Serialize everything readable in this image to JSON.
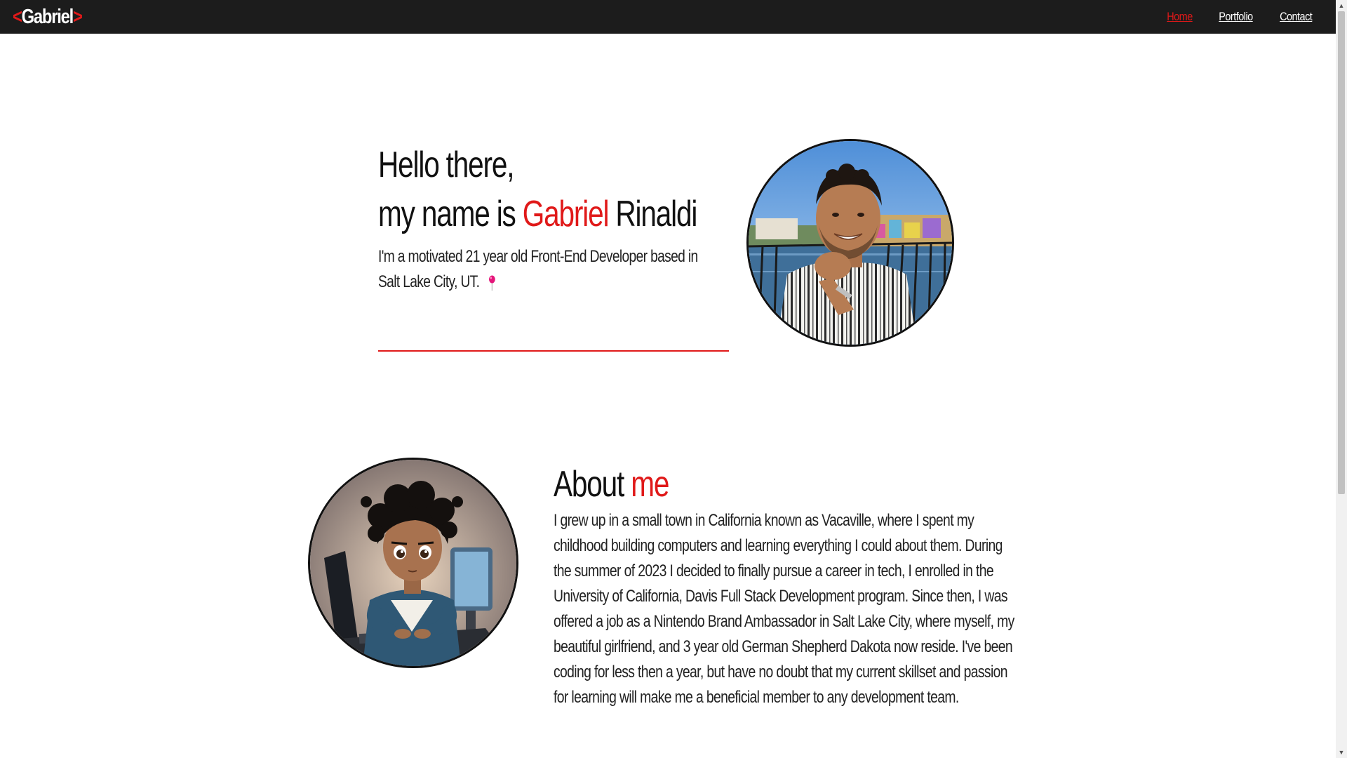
{
  "nav": {
    "logo_left": "<",
    "logo_name": "Gabriel",
    "logo_right": ">",
    "links": [
      {
        "label": "Home",
        "active": true
      },
      {
        "label": "Portfolio",
        "active": false
      },
      {
        "label": "Contact",
        "active": false
      }
    ]
  },
  "hero": {
    "line1": "Hello there,",
    "line2_prefix": "my name is ",
    "first_name": "Gabriel",
    "last_name": " Rinaldi",
    "description_line1": "I'm a motivated 21 year old Front-End Developer based in",
    "description_line2": "Salt Lake City, UT.",
    "pin_icon": "location-pin-icon"
  },
  "about": {
    "title_word": "About ",
    "title_accent": "me",
    "text": "I grew up in a small town in California known as Vacaville, where I spent my childhood building computers and learning everything I could about them. During the summer of 2023 I decided to finally pursue a career in tech, I enrolled in the University of California, Davis Full Stack Development program. Since then, I was offered a job as a Nintendo Brand Ambassador in Salt Lake City, where myself, my beautiful girlfriend, and 3 year old German Shepherd Dakota now reside. I've been coding for less then a year, but have no doubt that my current skillset and passion for learning will make me a beneficial member to any development team."
  },
  "colors": {
    "accent": "#e01919",
    "nav_bg": "#1c1c1c",
    "text": "#111111"
  }
}
